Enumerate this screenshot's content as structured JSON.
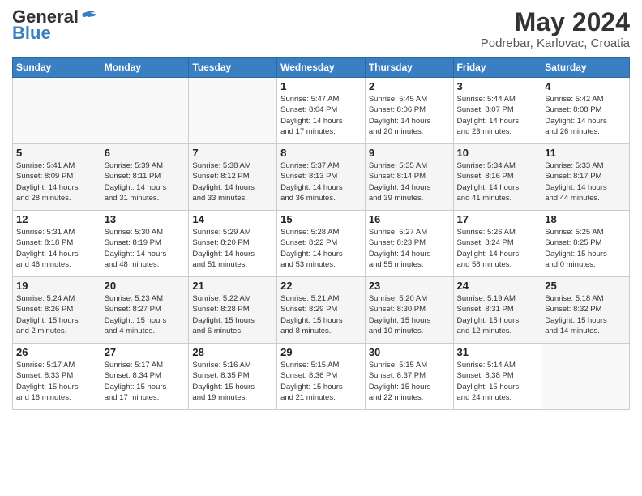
{
  "logo": {
    "line1": "General",
    "line2": "Blue"
  },
  "title": "May 2024",
  "location": "Podrebar, Karlovac, Croatia",
  "days_of_week": [
    "Sunday",
    "Monday",
    "Tuesday",
    "Wednesday",
    "Thursday",
    "Friday",
    "Saturday"
  ],
  "weeks": [
    [
      {
        "day": "",
        "info": ""
      },
      {
        "day": "",
        "info": ""
      },
      {
        "day": "",
        "info": ""
      },
      {
        "day": "1",
        "info": "Sunrise: 5:47 AM\nSunset: 8:04 PM\nDaylight: 14 hours\nand 17 minutes."
      },
      {
        "day": "2",
        "info": "Sunrise: 5:45 AM\nSunset: 8:06 PM\nDaylight: 14 hours\nand 20 minutes."
      },
      {
        "day": "3",
        "info": "Sunrise: 5:44 AM\nSunset: 8:07 PM\nDaylight: 14 hours\nand 23 minutes."
      },
      {
        "day": "4",
        "info": "Sunrise: 5:42 AM\nSunset: 8:08 PM\nDaylight: 14 hours\nand 26 minutes."
      }
    ],
    [
      {
        "day": "5",
        "info": "Sunrise: 5:41 AM\nSunset: 8:09 PM\nDaylight: 14 hours\nand 28 minutes."
      },
      {
        "day": "6",
        "info": "Sunrise: 5:39 AM\nSunset: 8:11 PM\nDaylight: 14 hours\nand 31 minutes."
      },
      {
        "day": "7",
        "info": "Sunrise: 5:38 AM\nSunset: 8:12 PM\nDaylight: 14 hours\nand 33 minutes."
      },
      {
        "day": "8",
        "info": "Sunrise: 5:37 AM\nSunset: 8:13 PM\nDaylight: 14 hours\nand 36 minutes."
      },
      {
        "day": "9",
        "info": "Sunrise: 5:35 AM\nSunset: 8:14 PM\nDaylight: 14 hours\nand 39 minutes."
      },
      {
        "day": "10",
        "info": "Sunrise: 5:34 AM\nSunset: 8:16 PM\nDaylight: 14 hours\nand 41 minutes."
      },
      {
        "day": "11",
        "info": "Sunrise: 5:33 AM\nSunset: 8:17 PM\nDaylight: 14 hours\nand 44 minutes."
      }
    ],
    [
      {
        "day": "12",
        "info": "Sunrise: 5:31 AM\nSunset: 8:18 PM\nDaylight: 14 hours\nand 46 minutes."
      },
      {
        "day": "13",
        "info": "Sunrise: 5:30 AM\nSunset: 8:19 PM\nDaylight: 14 hours\nand 48 minutes."
      },
      {
        "day": "14",
        "info": "Sunrise: 5:29 AM\nSunset: 8:20 PM\nDaylight: 14 hours\nand 51 minutes."
      },
      {
        "day": "15",
        "info": "Sunrise: 5:28 AM\nSunset: 8:22 PM\nDaylight: 14 hours\nand 53 minutes."
      },
      {
        "day": "16",
        "info": "Sunrise: 5:27 AM\nSunset: 8:23 PM\nDaylight: 14 hours\nand 55 minutes."
      },
      {
        "day": "17",
        "info": "Sunrise: 5:26 AM\nSunset: 8:24 PM\nDaylight: 14 hours\nand 58 minutes."
      },
      {
        "day": "18",
        "info": "Sunrise: 5:25 AM\nSunset: 8:25 PM\nDaylight: 15 hours\nand 0 minutes."
      }
    ],
    [
      {
        "day": "19",
        "info": "Sunrise: 5:24 AM\nSunset: 8:26 PM\nDaylight: 15 hours\nand 2 minutes."
      },
      {
        "day": "20",
        "info": "Sunrise: 5:23 AM\nSunset: 8:27 PM\nDaylight: 15 hours\nand 4 minutes."
      },
      {
        "day": "21",
        "info": "Sunrise: 5:22 AM\nSunset: 8:28 PM\nDaylight: 15 hours\nand 6 minutes."
      },
      {
        "day": "22",
        "info": "Sunrise: 5:21 AM\nSunset: 8:29 PM\nDaylight: 15 hours\nand 8 minutes."
      },
      {
        "day": "23",
        "info": "Sunrise: 5:20 AM\nSunset: 8:30 PM\nDaylight: 15 hours\nand 10 minutes."
      },
      {
        "day": "24",
        "info": "Sunrise: 5:19 AM\nSunset: 8:31 PM\nDaylight: 15 hours\nand 12 minutes."
      },
      {
        "day": "25",
        "info": "Sunrise: 5:18 AM\nSunset: 8:32 PM\nDaylight: 15 hours\nand 14 minutes."
      }
    ],
    [
      {
        "day": "26",
        "info": "Sunrise: 5:17 AM\nSunset: 8:33 PM\nDaylight: 15 hours\nand 16 minutes."
      },
      {
        "day": "27",
        "info": "Sunrise: 5:17 AM\nSunset: 8:34 PM\nDaylight: 15 hours\nand 17 minutes."
      },
      {
        "day": "28",
        "info": "Sunrise: 5:16 AM\nSunset: 8:35 PM\nDaylight: 15 hours\nand 19 minutes."
      },
      {
        "day": "29",
        "info": "Sunrise: 5:15 AM\nSunset: 8:36 PM\nDaylight: 15 hours\nand 21 minutes."
      },
      {
        "day": "30",
        "info": "Sunrise: 5:15 AM\nSunset: 8:37 PM\nDaylight: 15 hours\nand 22 minutes."
      },
      {
        "day": "31",
        "info": "Sunrise: 5:14 AM\nSunset: 8:38 PM\nDaylight: 15 hours\nand 24 minutes."
      },
      {
        "day": "",
        "info": ""
      }
    ]
  ]
}
